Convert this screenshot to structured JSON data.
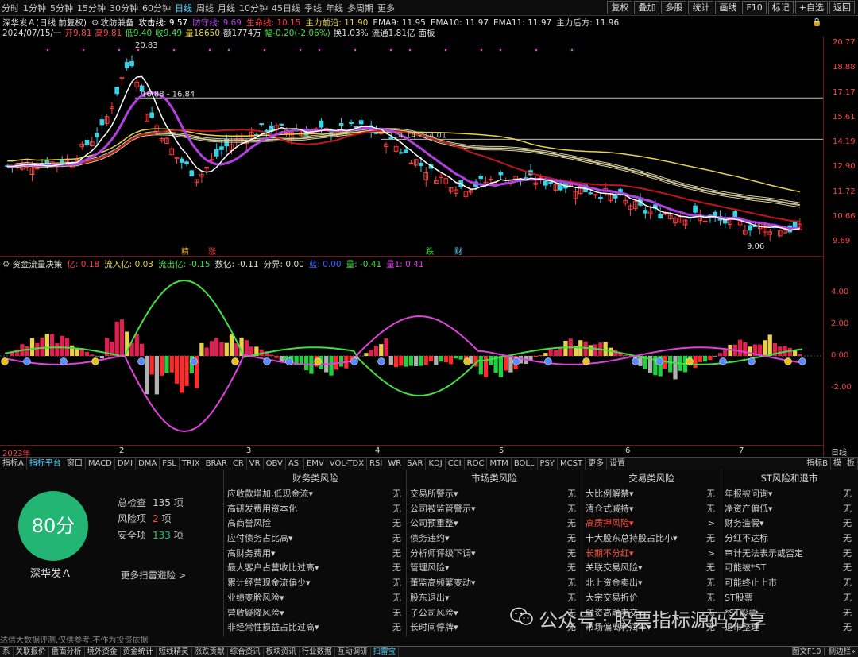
{
  "toolbar": {
    "periods": [
      "分时",
      "1分钟",
      "5分钟",
      "15分钟",
      "30分钟",
      "60分钟",
      "日线",
      "周线",
      "月线",
      "10分钟",
      "45日线",
      "季线",
      "年线",
      "多周期",
      "更多"
    ],
    "active_period": "日线",
    "right_buttons": [
      "复权",
      "叠加",
      "多股",
      "统计",
      "画线",
      "F10",
      "标记",
      "+自选",
      "返回"
    ]
  },
  "header": {
    "stock": "深华发Ａ",
    "mode": "(日线 前复权)",
    "indicator_name": "攻防兼备",
    "attack_label": "攻击线: 9.57",
    "defend_label": "防守线: 9.69",
    "life_label": "生命线: 10.15",
    "main_front": "主力前沿: 11.90",
    "ema9": "EMA9: 11.95",
    "ema10": "EMA10: 11.97",
    "ema11": "EMA11: 11.97",
    "main_back": "主力后方: 11.96",
    "date": "2024/07/15/一",
    "open": "开9.81",
    "high": "高9.81",
    "low": "低9.40",
    "close": "收9.49",
    "volume": "量18650",
    "amount": "额1774万",
    "change": "幅-0.20(-2.06%)",
    "turnover": "换1.03%",
    "float": "流通1.81亿",
    "board": "面板"
  },
  "price_axis": [
    "20.77",
    "18.88",
    "17.17",
    "15.61",
    "14.19",
    "12.90",
    "11.72",
    "10.66",
    "9.69"
  ],
  "price_annotations": {
    "high_mark": "20.83",
    "range_mark": "16.88 - 16.84",
    "mid_mark": "14.14 - 14.01",
    "low_mark": "9.06",
    "tag1": "精",
    "tag2": "涨",
    "tag3": "跌",
    "tag4": "财"
  },
  "indicator_header": {
    "name": "资金流量决策",
    "yi": "亿: 0.18",
    "inflow": "流入亿: 0.03",
    "outflow": "流出亿: -0.15",
    "net": "数亿: -0.11",
    "boundary": "分界: 0.00",
    "blue": "蓝: 0.00",
    "liang": "量: -0.41",
    "liang1": "量1: 0.41"
  },
  "indicator_axis": [
    "4.00",
    "2.00",
    "0.00",
    "-2.00"
  ],
  "time_axis": {
    "year": "2023年",
    "months": [
      "2",
      "3",
      "4",
      "5",
      "6",
      "7"
    ],
    "right": "日线"
  },
  "tabs": [
    "指标A",
    "指标平台",
    "窗口",
    "MACD",
    "DMI",
    "DMA",
    "FSL",
    "TRIX",
    "BRAR",
    "CR",
    "VR",
    "OBV",
    "ASI",
    "EMV",
    "VOL-TDX",
    "RSI",
    "WR",
    "SAR",
    "KDJ",
    "CCI",
    "ROC",
    "MTM",
    "BOLL",
    "PSY",
    "MCST",
    "更多",
    "设置"
  ],
  "tabs_right": [
    "指标B",
    "模",
    "板"
  ],
  "risk": {
    "score": "80分",
    "stock_name": "深华发Ａ",
    "total_label": "总检查",
    "total_value": "135",
    "total_unit": "项",
    "risk_label": "风险项",
    "risk_value": "2",
    "risk_unit": "项",
    "safe_label": "安全项",
    "safe_value": "133",
    "safe_unit": "项",
    "more_link": "更多扫雷避险 >",
    "columns": [
      {
        "title": "财务类风险",
        "items": [
          {
            "label": "应收款增加,低现金流▾",
            "value": "无"
          },
          {
            "label": "高研发费用资本化",
            "value": "无"
          },
          {
            "label": "高商誉风险",
            "value": "无"
          },
          {
            "label": "应付债务占比高▾",
            "value": "无"
          },
          {
            "label": "高财务费用▾",
            "value": "无"
          },
          {
            "label": "最大客户占营收比过高▾",
            "value": "无"
          },
          {
            "label": "累计经营现金流偏少▾",
            "value": "无"
          },
          {
            "label": "业绩变脸风险▾",
            "value": "无"
          },
          {
            "label": "营收疑降风险▾",
            "value": "无"
          },
          {
            "label": "非经常性损益占比过高▾",
            "value": "无"
          }
        ]
      },
      {
        "title": "市场类风险",
        "items": [
          {
            "label": "交易所警示▾",
            "value": "无"
          },
          {
            "label": "公司被监管警示▾",
            "value": "无"
          },
          {
            "label": "公司预重整▾",
            "value": "无"
          },
          {
            "label": "债务违约▾",
            "value": "无"
          },
          {
            "label": "分析师评级下调▾",
            "value": "无"
          },
          {
            "label": "管理风险▾",
            "value": "无"
          },
          {
            "label": "董监高频繁变动▾",
            "value": "无"
          },
          {
            "label": "股东退出▾",
            "value": "无"
          },
          {
            "label": "子公司风险▾",
            "value": "无"
          },
          {
            "label": "长时间停牌▾",
            "value": "无"
          }
        ]
      },
      {
        "title": "交易类风险",
        "items": [
          {
            "label": "大比例解禁▾",
            "value": "无"
          },
          {
            "label": "清仓式减持▾",
            "value": "无"
          },
          {
            "label": "高质押风险▾",
            "value": ">",
            "red": true
          },
          {
            "label": "十大股东总持股占比小▾",
            "value": "无"
          },
          {
            "label": "长期不分红▾",
            "value": ">",
            "red": true
          },
          {
            "label": "关联交易风险▾",
            "value": "无"
          },
          {
            "label": "北上资金卖出▾",
            "value": "无"
          },
          {
            "label": "大宗交易折价",
            "value": "无"
          },
          {
            "label": "融资高融卖交▾",
            "value": "无"
          },
          {
            "label": "市场偏离利润率▾",
            "value": "无"
          }
        ]
      },
      {
        "title": "ST风险和退市",
        "items": [
          {
            "label": "年报被问询▾",
            "value": "无"
          },
          {
            "label": "净资产偏低▾",
            "value": "无"
          },
          {
            "label": "财务造假▾",
            "value": "无"
          },
          {
            "label": "分红不达标",
            "value": "无"
          },
          {
            "label": "审计无法表示或否定",
            "value": "无"
          },
          {
            "label": "可能被*ST",
            "value": "无"
          },
          {
            "label": "可能终止上市",
            "value": "无"
          },
          {
            "label": "ST股票",
            "value": "无"
          },
          {
            "label": "*ST股票",
            "value": "无"
          },
          {
            "label": "退市整理",
            "value": "无"
          }
        ]
      }
    ],
    "disclaimer": "达信大数据评测,仅供参考,不作为投资依据",
    "watermark": "公众号 · 股票指标源码分享"
  },
  "taskbar": [
    "系",
    "关联报价",
    "盘面分析",
    "境外资金",
    "资金统计",
    "短线精灵",
    "涨跌贡献",
    "综合资讯",
    "板块资讯",
    "行业数据",
    "互动调研",
    "扫雷宝"
  ],
  "taskbar_right": "图文F10 | 侧边栏»",
  "colors": {
    "up": "#ff3b3b",
    "down": "#35d3e6",
    "purple": "#b040e0",
    "white": "#ffffff",
    "red_line": "#c0151b",
    "yellow": "#e8d24a",
    "green_wave": "#40e040",
    "magenta_wave": "#e040e0"
  }
}
